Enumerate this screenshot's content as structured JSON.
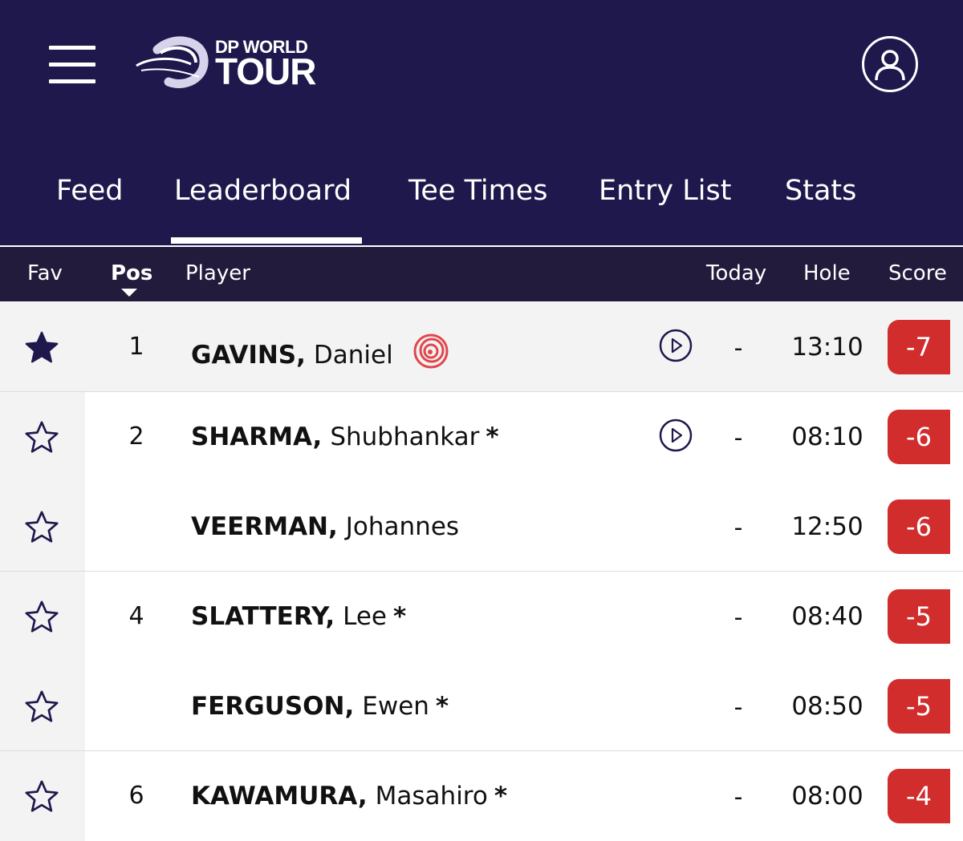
{
  "header": {
    "logo_small": "DP WORLD",
    "logo_large": "TOUR"
  },
  "tabs": [
    {
      "label": "Feed",
      "active": false
    },
    {
      "label": "Leaderboard",
      "active": true
    },
    {
      "label": "Tee Times",
      "active": false
    },
    {
      "label": "Entry List",
      "active": false
    },
    {
      "label": "Stats",
      "active": false
    }
  ],
  "columns": {
    "fav": "Fav",
    "pos": "Pos",
    "player": "Player",
    "today": "Today",
    "hole": "Hole",
    "score": "Score"
  },
  "rows": [
    {
      "pos": "1",
      "last": "GAVINS,",
      "first": "Daniel",
      "mark": "",
      "today": "-",
      "hole": "13:10",
      "score": "-7",
      "favourite": true,
      "video": true,
      "badge_icon": "spiral-badge-icon"
    },
    {
      "pos": "2",
      "last": "SHARMA,",
      "first": "Shubhankar",
      "mark": "*",
      "today": "-",
      "hole": "08:10",
      "score": "-6",
      "favourite": false,
      "video": true
    },
    {
      "pos": "",
      "last": "VEERMAN,",
      "first": "Johannes",
      "mark": "",
      "today": "-",
      "hole": "12:50",
      "score": "-6",
      "favourite": false,
      "video": false
    },
    {
      "pos": "4",
      "last": "SLATTERY,",
      "first": "Lee",
      "mark": "*",
      "today": "-",
      "hole": "08:40",
      "score": "-5",
      "favourite": false,
      "video": false
    },
    {
      "pos": "",
      "last": "FERGUSON,",
      "first": "Ewen",
      "mark": "*",
      "today": "-",
      "hole": "08:50",
      "score": "-5",
      "favourite": false,
      "video": false
    },
    {
      "pos": "6",
      "last": "KAWAMURA,",
      "first": "Masahiro",
      "mark": "*",
      "today": "-",
      "hole": "08:00",
      "score": "-4",
      "favourite": false,
      "video": false
    }
  ],
  "colors": {
    "nav_bg": "#1e184c",
    "header_bg": "#221b3c",
    "score_red": "#d12d2d",
    "star_fill": "#1e184c"
  }
}
